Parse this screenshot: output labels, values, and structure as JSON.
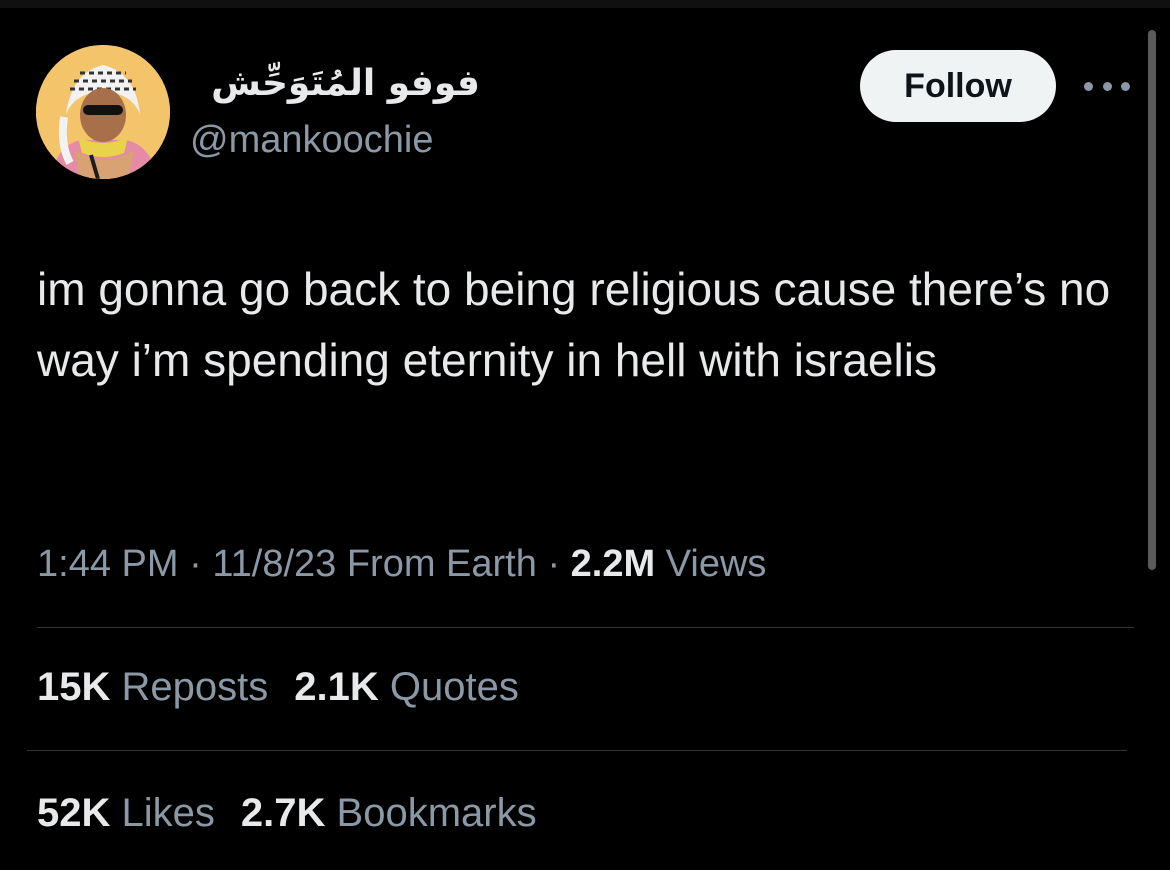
{
  "author": {
    "display_name": "فوفو المُتَوَحِّش",
    "handle": "@mankoochie"
  },
  "follow_label": "Follow",
  "tweet": {
    "text": "im gonna go back to being religious cause there’s no way i’m spending eternity in hell with israelis"
  },
  "meta": {
    "time": "1:44 PM",
    "sep1": " · ",
    "date": "11/8/23",
    "source": " From Earth",
    "sep2": " · ",
    "views_count": "2.2M",
    "views_label": " Views"
  },
  "stats": {
    "reposts_count": "15K",
    "reposts_label": "Reposts",
    "quotes_count": "2.1K",
    "quotes_label": "Quotes",
    "likes_count": "52K",
    "likes_label": "Likes",
    "bookmarks_count": "2.7K",
    "bookmarks_label": "Bookmarks"
  },
  "icons": {
    "more": "more-horizontal-icon"
  },
  "colors": {
    "background": "#000000",
    "primary_text": "#e7e9ea",
    "secondary_text": "#8b98a5",
    "follow_button_bg": "#eff3f4",
    "divider": "#2f3336"
  }
}
